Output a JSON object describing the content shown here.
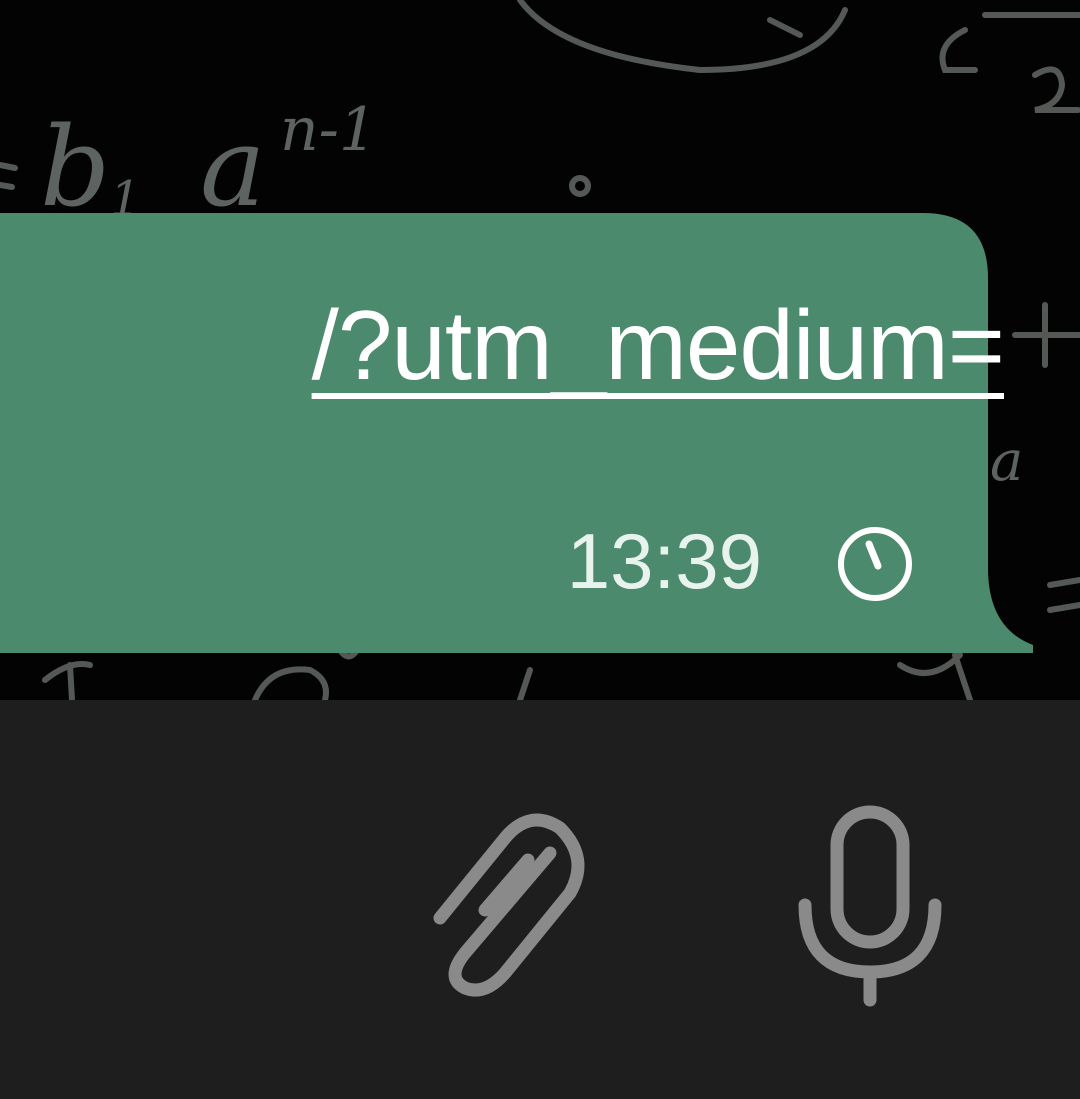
{
  "message": {
    "link_text": "/?utm_medium=",
    "time": "13:39",
    "status_icon": "clock-icon",
    "bubble_color": "#4c8a6d"
  },
  "composer": {
    "background": "#1e1e1e",
    "attach_icon": "paperclip-icon",
    "voice_icon": "microphone-icon",
    "icon_color": "#8a8a8a"
  },
  "chat_background": {
    "color": "#030303",
    "doodle_text": {
      "b": "b",
      "sub1": "1",
      "a": "a",
      "exp": "n-1",
      "two": "2",
      "a_small": "a",
      "plus": "+"
    }
  }
}
